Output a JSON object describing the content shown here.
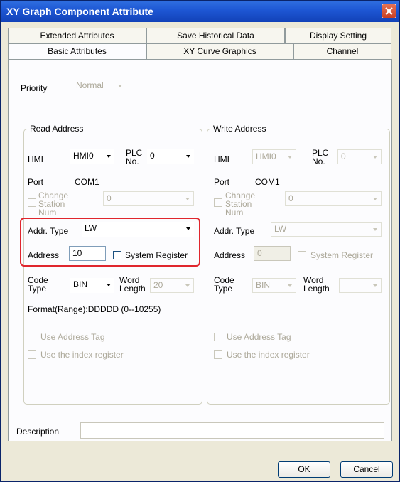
{
  "window": {
    "title": "XY Graph Component Attribute"
  },
  "tabs": {
    "row1": [
      "Extended Attributes",
      "Save Historical Data",
      "Display Setting"
    ],
    "row2": [
      "Basic Attributes",
      "XY Curve Graphics",
      "Channel"
    ],
    "active": "Basic Attributes"
  },
  "priority": {
    "label": "Priority",
    "value": "Normal"
  },
  "read": {
    "title": "Read Address",
    "hmi_label": "HMI",
    "hmi_value": "HMI0",
    "plc_label": "PLC No.",
    "plc_value": "0",
    "port_label": "Port",
    "port_value": "COM1",
    "change_station_label": "Change Station Num",
    "change_station_value": "0",
    "addr_type_label": "Addr. Type",
    "addr_type_value": "LW",
    "address_label": "Address",
    "address_value": "10",
    "system_register_label": "System Register",
    "code_type_label": "Code Type",
    "code_type_value": "BIN",
    "word_length_label": "Word Length",
    "word_length_value": "20",
    "format_text": "Format(Range):DDDDD (0--10255)",
    "use_address_tag_label": "Use Address Tag",
    "use_index_register_label": "Use the index register"
  },
  "write": {
    "title": "Write Address",
    "hmi_label": "HMI",
    "hmi_value": "HMI0",
    "plc_label": "PLC No.",
    "plc_value": "0",
    "port_label": "Port",
    "port_value": "COM1",
    "change_station_label": "Change Station Num",
    "change_station_value": "0",
    "addr_type_label": "Addr. Type",
    "addr_type_value": "LW",
    "address_label": "Address",
    "address_value": "0",
    "system_register_label": "System Register",
    "code_type_label": "Code Type",
    "code_type_value": "BIN",
    "word_length_label": "Word Length",
    "word_length_value": "",
    "use_address_tag_label": "Use Address Tag",
    "use_index_register_label": "Use the index register"
  },
  "description": {
    "label": "Description",
    "value": ""
  },
  "buttons": {
    "ok": "OK",
    "cancel": "Cancel"
  },
  "colors": {
    "title_bar": "#1d56d3",
    "highlight": "#e0262d",
    "close": "#c94024"
  },
  "icons": {
    "close": "close-icon",
    "dropdown": "chevron-down-icon"
  }
}
